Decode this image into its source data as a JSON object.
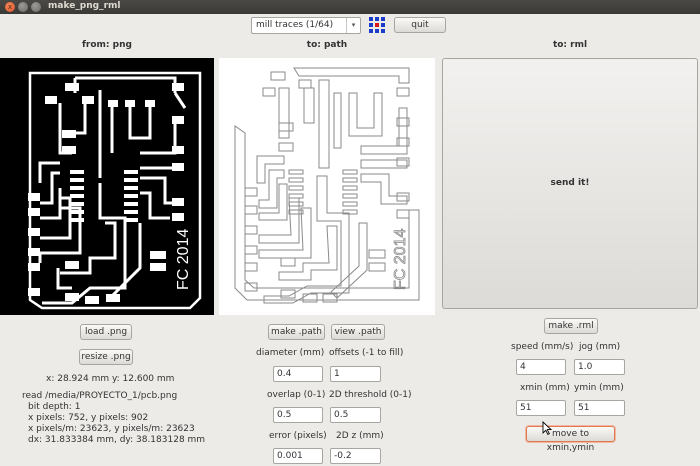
{
  "window": {
    "title": "make_png_rml",
    "close_glyph": "x"
  },
  "toolbar": {
    "mode_select": "mill traces (1/64)",
    "select_arrow": "▾",
    "quit_label": "quit"
  },
  "columns": {
    "png_header": "from: png",
    "path_header": "to: path",
    "rml_header": "to: rml"
  },
  "png": {
    "board_text": "FC 2014",
    "load_label": "load .png",
    "resize_label": "resize .png",
    "size_line": "x: 28.924 mm  y: 12.600 mm",
    "info_lines": [
      "read /media/PROYECTO_1/pcb.png",
      "bit depth: 1",
      "x pixels: 752, y pixels: 902",
      "x pixels/m: 23623, y pixels/m: 23623",
      "dx: 31.833384 mm, dy: 38.183128 mm"
    ]
  },
  "path": {
    "board_text": "FC 2014",
    "make_label": "make .path",
    "view_label": "view .path",
    "diameter_label": "diameter (mm)",
    "diameter_value": "0.4",
    "offsets_label": "offsets (-1 to fill)",
    "offsets_value": "1",
    "overlap_label": "overlap (0-1)",
    "overlap_value": "0.5",
    "threshold_label": "2D threshold (0-1)",
    "threshold_value": "0.5",
    "error_label": "error (pixels)",
    "error_value": "0.001",
    "z_label": "2D z (mm)",
    "z_value": "-0.2"
  },
  "rml": {
    "send_label": "send it!",
    "make_label": "make .rml",
    "speed_label": "speed (mm/s)",
    "speed_value": "4",
    "jog_label": "jog (mm)",
    "jog_value": "1.0",
    "xmin_label": "xmin (mm)",
    "xmin_value": "51",
    "ymin_label": "ymin (mm)",
    "ymin_value": "51",
    "move_label": "move to xmin,ymin"
  },
  "colors": {
    "titlebar": "#3c3b37",
    "window_bg": "#ecebe8",
    "close_button": "#e2562a",
    "grid_icon_blue": "#1a3cc8",
    "grid_icon_red": "#d81818"
  }
}
